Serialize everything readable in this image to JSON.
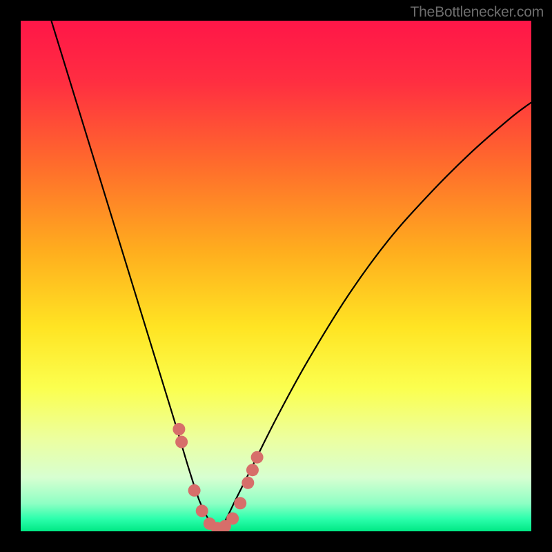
{
  "watermark": "TheBottlenecker.com",
  "gradient": {
    "stops": [
      {
        "offset": 0.0,
        "color": "#ff1648"
      },
      {
        "offset": 0.12,
        "color": "#ff2e41"
      },
      {
        "offset": 0.28,
        "color": "#ff6b2c"
      },
      {
        "offset": 0.45,
        "color": "#ffad1e"
      },
      {
        "offset": 0.6,
        "color": "#ffe423"
      },
      {
        "offset": 0.72,
        "color": "#fbff4f"
      },
      {
        "offset": 0.82,
        "color": "#ecffa0"
      },
      {
        "offset": 0.895,
        "color": "#d7ffd1"
      },
      {
        "offset": 0.945,
        "color": "#8fffc4"
      },
      {
        "offset": 0.975,
        "color": "#2dffad"
      },
      {
        "offset": 1.0,
        "color": "#00e884"
      }
    ]
  },
  "chart_data": {
    "type": "line",
    "title": "",
    "xlabel": "",
    "ylabel": "",
    "xlim": [
      0,
      100
    ],
    "ylim": [
      0,
      100
    ],
    "series": [
      {
        "name": "bottleneck-curve",
        "x": [
          6,
          10,
          14,
          18,
          22,
          26,
          30,
          33,
          35,
          37,
          38.5,
          40,
          42,
          45,
          50,
          56,
          64,
          72,
          80,
          88,
          96,
          100
        ],
        "values": [
          100,
          87,
          74,
          61,
          48,
          35,
          22,
          12,
          6,
          2,
          0.5,
          2,
          6,
          12,
          22,
          33,
          46,
          57,
          66,
          74,
          81,
          84
        ]
      }
    ],
    "markers": {
      "name": "highlight-dots",
      "color": "#d76e6a",
      "x": [
        31.0,
        31.5,
        34.0,
        35.5,
        37.0,
        38.5,
        40.0,
        41.5,
        43.0,
        44.5,
        45.4,
        46.3
      ],
      "values": [
        20.0,
        17.5,
        8.0,
        4.0,
        1.5,
        0.6,
        1.0,
        2.5,
        5.5,
        9.5,
        12.0,
        14.5
      ]
    }
  }
}
